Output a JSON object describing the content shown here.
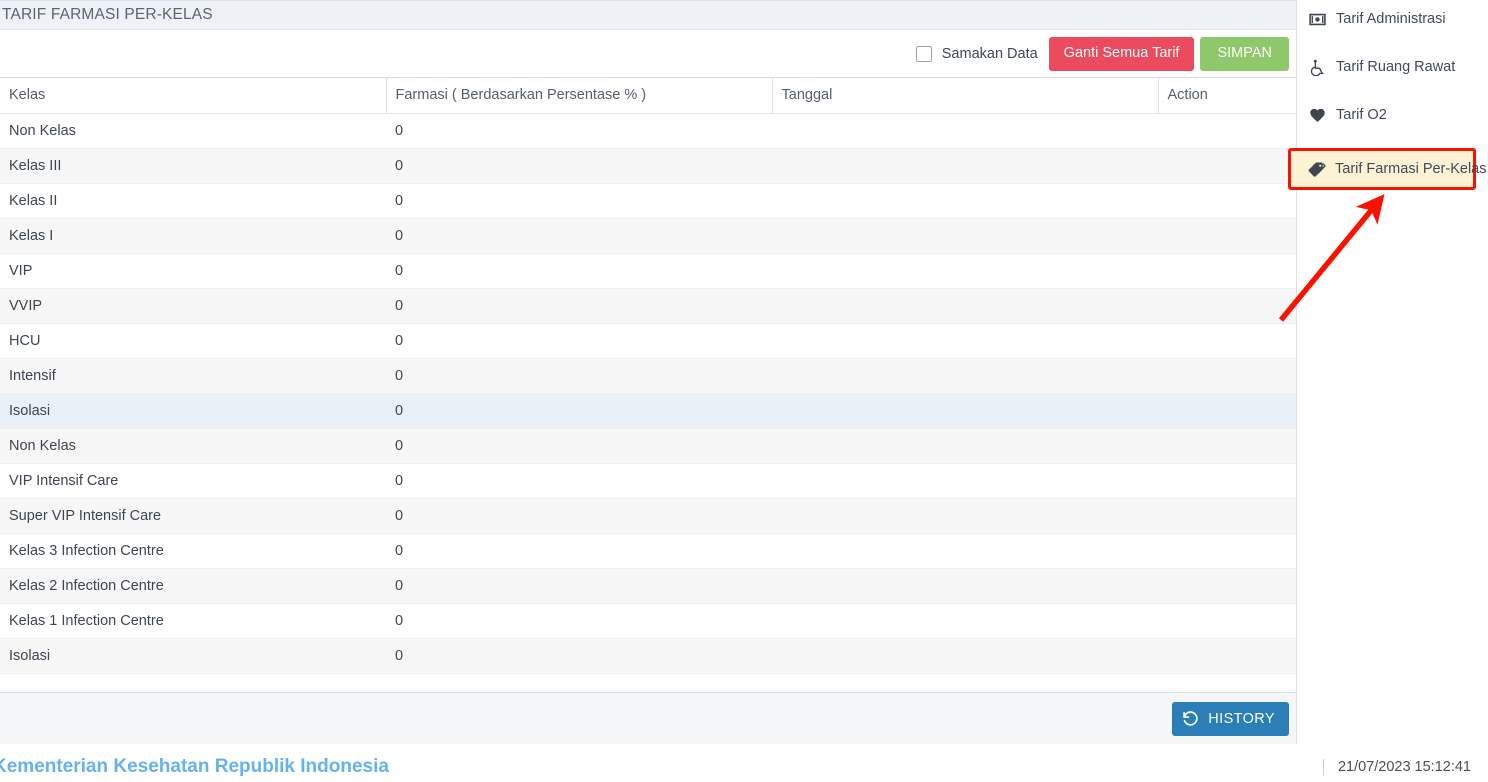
{
  "panel": {
    "title": "TARIF FARMASI PER-KELAS"
  },
  "toolbar": {
    "checkbox_label": "Samakan Data",
    "checkbox_checked": false,
    "replace_all_label": "Ganti Semua Tarif",
    "save_label": "SIMPAN",
    "danger_color": "#ec4a5e",
    "success_color": "#8fc86a"
  },
  "table": {
    "columns": [
      "Kelas",
      "Farmasi ( Berdasarkan Persentase % )",
      "Tanggal",
      "Action"
    ],
    "rows": [
      {
        "kelas": "Non Kelas",
        "farmasi": "0",
        "tanggal": "",
        "action": ""
      },
      {
        "kelas": "Kelas III",
        "farmasi": "0",
        "tanggal": "",
        "action": ""
      },
      {
        "kelas": "Kelas II",
        "farmasi": "0",
        "tanggal": "",
        "action": ""
      },
      {
        "kelas": "Kelas I",
        "farmasi": "0",
        "tanggal": "",
        "action": ""
      },
      {
        "kelas": "VIP",
        "farmasi": "0",
        "tanggal": "",
        "action": ""
      },
      {
        "kelas": "VVIP",
        "farmasi": "0",
        "tanggal": "",
        "action": ""
      },
      {
        "kelas": "HCU",
        "farmasi": "0",
        "tanggal": "",
        "action": ""
      },
      {
        "kelas": "Intensif",
        "farmasi": "0",
        "tanggal": "",
        "action": ""
      },
      {
        "kelas": "Isolasi",
        "farmasi": "0",
        "tanggal": "",
        "action": ""
      },
      {
        "kelas": "Non Kelas",
        "farmasi": "0",
        "tanggal": "",
        "action": ""
      },
      {
        "kelas": "VIP Intensif Care",
        "farmasi": "0",
        "tanggal": "",
        "action": ""
      },
      {
        "kelas": "Super VIP Intensif Care",
        "farmasi": "0",
        "tanggal": "",
        "action": ""
      },
      {
        "kelas": "Kelas 3 Infection Centre",
        "farmasi": "0",
        "tanggal": "",
        "action": ""
      },
      {
        "kelas": "Kelas 2 Infection Centre",
        "farmasi": "0",
        "tanggal": "",
        "action": ""
      },
      {
        "kelas": "Kelas 1 Infection Centre",
        "farmasi": "0",
        "tanggal": "",
        "action": ""
      },
      {
        "kelas": "Isolasi",
        "farmasi": "0",
        "tanggal": "",
        "action": ""
      }
    ],
    "highlighted_row_index": 8
  },
  "panel_footer": {
    "history_label": "HISTORY",
    "history_color": "#2a7fb8",
    "history_icon": "undo-icon"
  },
  "sidebar": {
    "items": [
      {
        "label": "Tarif Administrasi",
        "icon": "money-bill-icon",
        "active": false
      },
      {
        "label": "Tarif Ruang Rawat",
        "icon": "wheelchair-icon",
        "active": false
      },
      {
        "label": "Tarif O2",
        "icon": "heart-icon",
        "active": false
      },
      {
        "label": "Tarif Farmasi Per-Kelas",
        "icon": "tag-icon",
        "active": true
      }
    ],
    "highlight_bg": "#fdf3d4",
    "highlight_border": "#fb1100"
  },
  "annotation": {
    "type": "arrow",
    "color": "#fb1100",
    "points_to": "Tarif Farmasi Per-Kelas"
  },
  "page_footer": {
    "brand": "Kementerian Kesehatan Republik Indonesia",
    "brand_color": "#65b2ef",
    "timestamp": "21/07/2023 15:12:41"
  }
}
